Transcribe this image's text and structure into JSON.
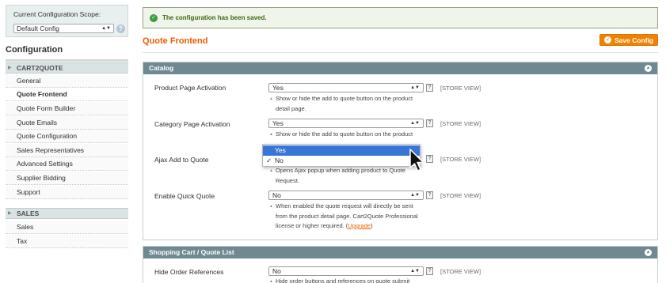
{
  "sidebar": {
    "scope_label": "Current Configuration Scope:",
    "scope_value": "Default Config",
    "help_glyph": "?",
    "title": "Configuration",
    "groups": [
      {
        "label": "CART2QUOTE"
      },
      {
        "label": "SALES"
      }
    ],
    "cart2quote_items": [
      {
        "label": "General"
      },
      {
        "label": "Quote Frontend"
      },
      {
        "label": "Quote Form Builder"
      },
      {
        "label": "Quote Emails"
      },
      {
        "label": "Quote Configuration"
      },
      {
        "label": "Sales Representatives"
      },
      {
        "label": "Advanced Settings"
      },
      {
        "label": "Supplier Bidding"
      },
      {
        "label": "Support"
      }
    ],
    "sales_items": [
      {
        "label": "Sales"
      },
      {
        "label": "Tax"
      }
    ],
    "active_item": "Quote Frontend"
  },
  "message": {
    "text": "The configuration has been saved.",
    "icon": "check-icon"
  },
  "page": {
    "title": "Quote Frontend",
    "save_label": "Save Config"
  },
  "sections": {
    "catalog": {
      "title": "Catalog",
      "rows": [
        {
          "label": "Product Page Activation",
          "value": "Yes",
          "scope": "[STORE VIEW]",
          "note": [
            "Show or hide the add to quote button on the product",
            "detail page."
          ]
        },
        {
          "label": "Category Page Activation",
          "value": "Yes",
          "scope": "[STORE VIEW]",
          "note": [
            "Show or hide the add to quote button on the product"
          ]
        },
        {
          "label": "Ajax Add to Quote",
          "value": "No",
          "scope": "[STORE VIEW]",
          "note": [
            "Opens Ajax popup when adding product to Quote",
            "Request."
          ]
        },
        {
          "label": "Enable Quick Quote",
          "value": "No",
          "scope": "[STORE VIEW]",
          "note": [
            "When enabled the quote request will directly be sent",
            "from the product detail page. Cart2Quote Professional",
            "license or higher required. ("
          ],
          "link": "Upgrade",
          "note_end": ")"
        }
      ]
    },
    "cart": {
      "title": "Shopping Cart / Quote List",
      "rows": [
        {
          "label": "Hide Order References",
          "value": "No",
          "scope": "[STORE VIEW]",
          "note": [
            "Hide order buttons and references on quote submit"
          ]
        }
      ]
    }
  },
  "dropdown": {
    "options": [
      "Yes",
      "No"
    ],
    "highlighted": "Yes",
    "checked": "No",
    "check_glyph": "✓"
  },
  "colors": {
    "accent": "#eb5e00",
    "button": "#f18200",
    "section_header": "#6f8992",
    "success_text": "#3d6611",
    "highlight": "#3875d7"
  }
}
